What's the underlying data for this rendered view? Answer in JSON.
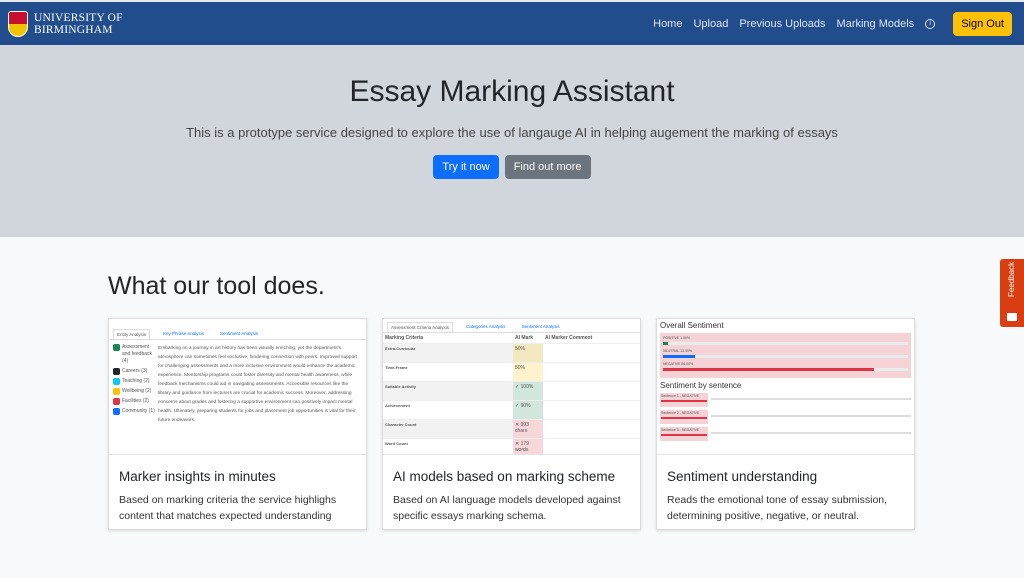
{
  "nav": {
    "logo_line1": "UNIVERSITY OF",
    "logo_line2": "BIRMINGHAM",
    "links": [
      "Home",
      "Upload",
      "Previous Uploads",
      "Marking Models"
    ],
    "info_icon": "info-circle-icon",
    "sign_out": "Sign Out",
    "color": "#214d8c"
  },
  "hero": {
    "title": "Essay Marking Assistant",
    "subtitle": "This is a prototype service designed to explore the use of langauge AI in helping augement the marking of essays",
    "try": "Try it now",
    "more": "Find out more"
  },
  "section": {
    "title": "What our tool does."
  },
  "cards": [
    {
      "title": "Marker insights in minutes",
      "text": "Based on marking criteria the service highlighs content that matches expected understanding",
      "preview": {
        "tabs": [
          "Entity Analysis",
          "Key Phrase Analysis",
          "Sentiment Analysis"
        ],
        "legend": [
          {
            "label": "Assessment and feedback (4)",
            "color": "#198754"
          },
          {
            "label": "Careers (3)",
            "color": "#212529"
          },
          {
            "label": "Teaching (2)",
            "color": "#0dcaf0"
          },
          {
            "label": "Wellbeing (2)",
            "color": "#ffc107"
          },
          {
            "label": "Facilities (2)",
            "color": "#dc3545"
          },
          {
            "label": "Community (1)",
            "color": "#0d6efd"
          }
        ],
        "text": "Embarking on a journey in art history has been visually enriching, yet the department's atmosphere can sometimes feel exclusive, hindering connection with peers. Improved support for challenging assessments and a more inclusive environment would enhance the academic experience. Mentorship programs could foster diversity and mental health awareness, while feedback mechanisms could aid in navigating assessments. Accessible resources like the library and guidance from lecturers are crucial for academic success. Moreover, addressing concerns about grades and fostering a supportive environment can positively impact mental health. Ultimately, preparing students for jobs and placement job opportunities is vital for their future endeavors."
      }
    },
    {
      "title": "AI models based on marking scheme",
      "text": "Based on AI language models developed against specific essays marking schema.",
      "preview": {
        "tabs": [
          "Assessment Criteria Analysis",
          "Categories Analysis",
          "Sentiment Analysis"
        ],
        "headers": [
          "Marking Criteria",
          "AI Mark",
          "AI Marker Comment"
        ],
        "rows": [
          {
            "c": "Extra-Curricular",
            "m": "50%",
            "bg": "#f3e9c0"
          },
          {
            "c": "Time-Frame",
            "m": "50%",
            "bg": "#fff3cd"
          },
          {
            "c": "Suitable Activity",
            "m": "✓ 100%",
            "bg": "#d1e7dd"
          },
          {
            "c": "Achievement",
            "m": "✓ 90%",
            "bg": "#d1e7dd"
          },
          {
            "c": "Character Count",
            "m": "✕ 993 chars",
            "bg": "#f8d7da"
          },
          {
            "c": "Word Count",
            "m": "✕ 179 words",
            "bg": "#f8d7da"
          }
        ]
      }
    },
    {
      "title": "Sentiment understanding",
      "text": "Reads the emotional tone of essay submission, determining positive, negative, or neutral.",
      "preview": {
        "overall": "Overall Sentiment",
        "by_sentence": "Sentiment by sentence",
        "levels": [
          {
            "label": "POSITIVE 1.00%",
            "value": 1,
            "color": "#198754"
          },
          {
            "label": "NEUTRAL 13.00%",
            "value": 13,
            "color": "#0d6efd"
          },
          {
            "label": "NEGATIVE 86.00%",
            "value": 86,
            "color": "#dc3545"
          }
        ],
        "sentences": [
          "Sentence 1 - NEGATIVE",
          "Sentence 2 - NEGATIVE",
          "Sentence 3 - NEGATIVE"
        ]
      }
    }
  ],
  "feedback": "Feedback"
}
